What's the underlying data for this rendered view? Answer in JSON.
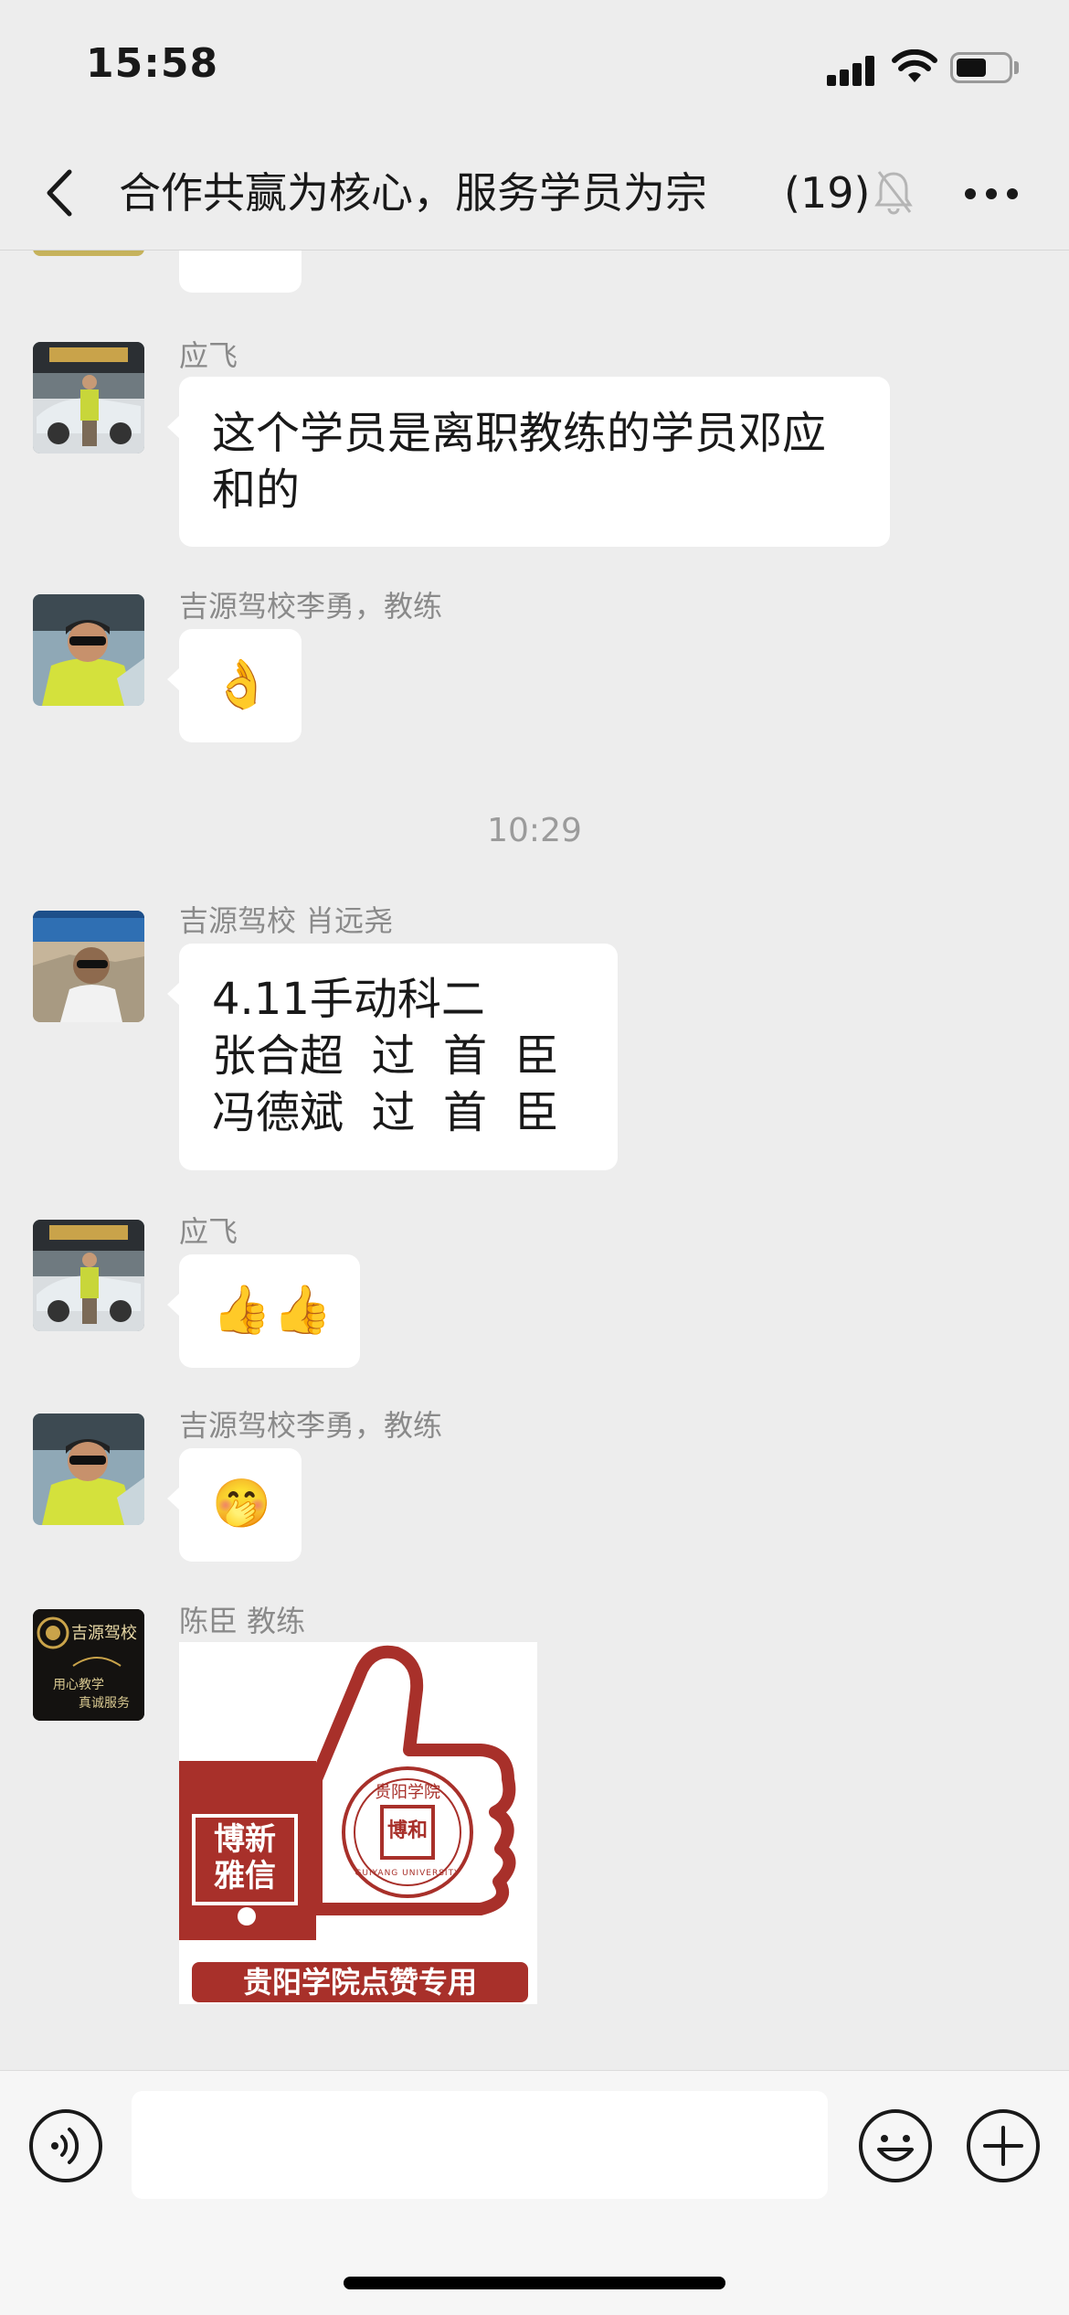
{
  "status_bar": {
    "time": "15:58",
    "battery_level": 0.6
  },
  "header": {
    "title": "合作共赢为核心，服务学员为宗",
    "member_count": "(19)",
    "icons": [
      "chevron-left-icon",
      "bell-muted-icon",
      "more-dots-icon"
    ]
  },
  "messages": [
    {
      "sender": "应飞",
      "text": "这个学员是离职教练的学员邓应和的",
      "lines": [
        "这个学员是离职教练的学员邓应",
        "和的"
      ]
    },
    {
      "sender": "吉源驾校李勇，教练",
      "emoji": "👌"
    },
    {
      "timestamp": "10:29"
    },
    {
      "sender": "吉源驾校 肖远尧",
      "lines": [
        "4.11手动科二",
        "张合超  过  首  臣",
        "冯德斌  过  首  臣"
      ]
    },
    {
      "sender": "应飞",
      "emoji": "👍👍"
    },
    {
      "sender": "吉源驾校李勇，教练",
      "emoji": "🤭"
    },
    {
      "sender": "陈臣 教练",
      "sticker": {
        "panel_text": [
          "博新",
          "雅信"
        ],
        "seal_text": "贵阳学院",
        "seal_ring_text": "GUIYANG UNIVERSITY",
        "seal_chars": "博和",
        "banner_text": "贵阳学院点赞专用"
      }
    }
  ],
  "avatar_logo": {
    "name": "吉源驾校",
    "lines": [
      "用心教学",
      "真诚服务"
    ]
  },
  "input_bar": {
    "placeholder": "",
    "icons": [
      "voice-icon",
      "emoji-icon",
      "plus-icon"
    ]
  },
  "colors": {
    "background": "#ededed",
    "bubble": "#ffffff",
    "sticker_red": "#a8302a",
    "name_gray": "#8a8a8a"
  }
}
